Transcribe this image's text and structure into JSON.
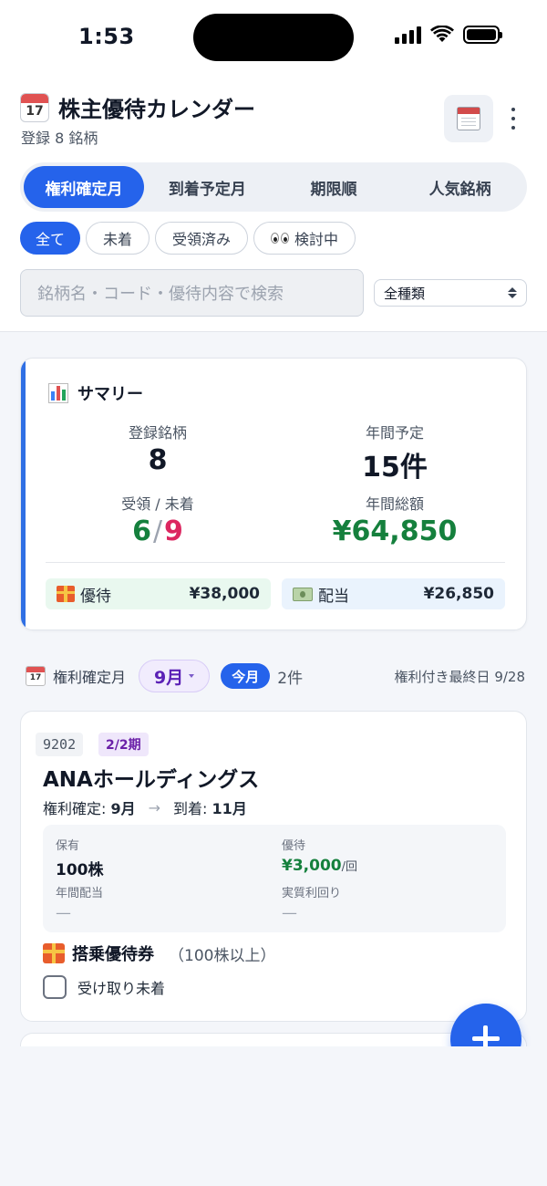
{
  "status_bar": {
    "time": "1:53"
  },
  "header": {
    "calendar_icon_day": "17",
    "title": "株主優待カレンダー",
    "subtitle": "登録 8 銘柄",
    "tabs": [
      {
        "label": "権利確定月",
        "active": true
      },
      {
        "label": "到着予定月",
        "active": false
      },
      {
        "label": "期限順",
        "active": false
      },
      {
        "label": "人気銘柄",
        "active": false
      }
    ],
    "filters": [
      {
        "label": "全て",
        "active": true
      },
      {
        "label": "未着",
        "active": false
      },
      {
        "label": "受領済み",
        "active": false
      },
      {
        "label": "検討中",
        "active": false,
        "icon": "eyes-icon"
      }
    ],
    "search_placeholder": "銘柄名・コード・優待内容で検索",
    "type_select_value": "全種類"
  },
  "summary": {
    "title": "サマリー",
    "registered_label": "登録銘柄",
    "registered_value": "8",
    "annual_label": "年間予定",
    "annual_value": "15件",
    "received_label": "受領 / 未着",
    "received_value": "6",
    "pending_value": "9",
    "total_label": "年間総額",
    "total_value": "¥64,850",
    "yutai_label": "優待",
    "yutai_amount": "¥38,000",
    "dividend_label": "配当",
    "dividend_amount": "¥26,850"
  },
  "month_bar": {
    "icon_day": "17",
    "label": "権利確定月",
    "month": "9月",
    "today_label": "今月",
    "count": "2件",
    "last_day_label": "権利付き最終日 9/28"
  },
  "stock_card": {
    "code": "9202",
    "period": "2/2期",
    "name": "ANAホールディングス",
    "record_label": "権利確定:",
    "record_month": "9月",
    "arrival_label": "到着:",
    "arrival_month": "11月",
    "holding_label": "保有",
    "holding_value": "100株",
    "benefit_label": "優待",
    "benefit_value": "¥3,000",
    "benefit_unit": "/回",
    "dividend_label": "年間配当",
    "dividend_value": "—",
    "yield_label": "実質利回り",
    "yield_value": "—",
    "benefit_name": "搭乗優待券",
    "benefit_condition": "（100株以上）",
    "received_checkbox_label": "受け取り未着",
    "received_checked": false
  },
  "colors": {
    "accent": "#2563eb",
    "green": "#15803d",
    "pink": "#dc2660",
    "purple": "#5b21b6"
  }
}
